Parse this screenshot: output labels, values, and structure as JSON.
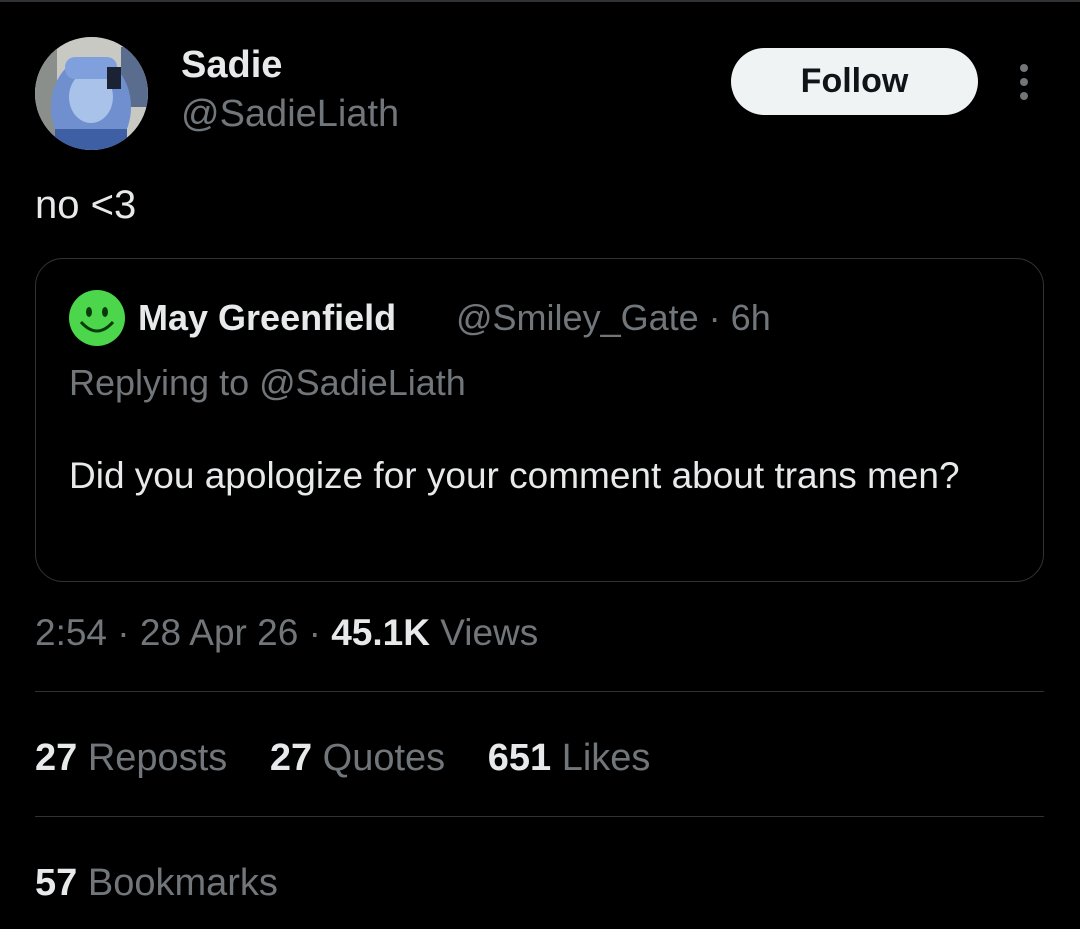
{
  "author": {
    "name": "Sadie",
    "handle": "@SadieLiath",
    "avatar_icon": "profile-photo"
  },
  "follow_button": {
    "label": "Follow"
  },
  "more_icon": "more-vertical-icon",
  "tweet": {
    "text": "no <3"
  },
  "quoted_tweet": {
    "author_name": "May Greenfield",
    "author_handle": "@Smiley_Gate",
    "separator": "·",
    "time": "6h",
    "replying_to_label": "Replying to",
    "replying_to_handle": "@SadieLiath",
    "text": "Did you apologize for your comment about trans men?",
    "avatar_icon": "smiley-face-icon",
    "avatar_color": "#4bd64b"
  },
  "meta": {
    "time": "2:54",
    "separator": "·",
    "date": "28 Apr 26",
    "views_count": "45.1K",
    "views_label": "Views"
  },
  "stats": {
    "reposts_count": "27",
    "reposts_label": "Reposts",
    "quotes_count": "27",
    "quotes_label": "Quotes",
    "likes_count": "651",
    "likes_label": "Likes",
    "bookmarks_count": "57",
    "bookmarks_label": "Bookmarks"
  },
  "colors": {
    "background": "#000000",
    "primary_text": "#e7e9ea",
    "secondary_text": "#71767b",
    "border": "#2f3336",
    "follow_bg": "#eff3f4"
  }
}
